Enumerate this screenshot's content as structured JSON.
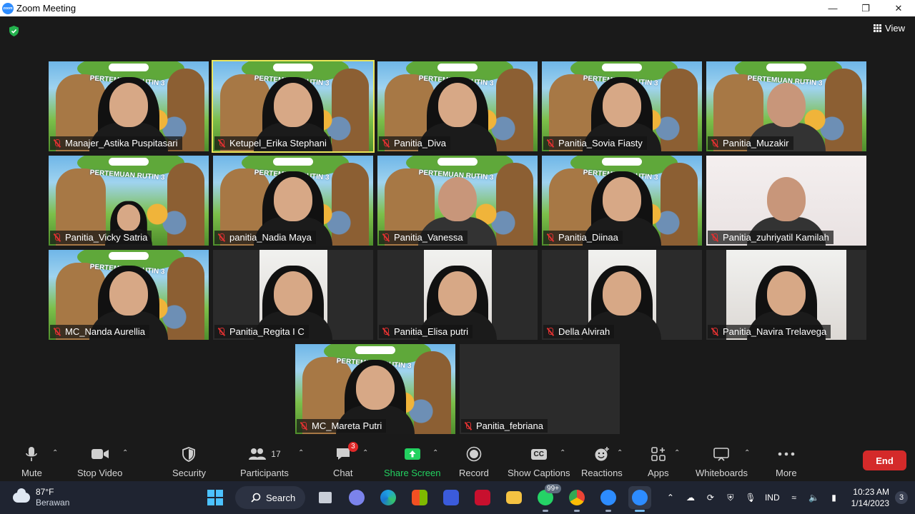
{
  "window": {
    "title": "Zoom Meeting",
    "app_icon_text": "zoom"
  },
  "header": {
    "view_label": "View"
  },
  "participants": [
    {
      "name": "Manajer_Astika Puspitasari"
    },
    {
      "name": "Ketupel_Erika Stephani"
    },
    {
      "name": "Panitia_Diva"
    },
    {
      "name": "Panitia_Sovia Fiasty"
    },
    {
      "name": "Panitia_Muzakir"
    },
    {
      "name": "Panitia_Vicky Satria"
    },
    {
      "name": "panitia_Nadia Maya"
    },
    {
      "name": "Panitia_Vanessa"
    },
    {
      "name": "Panitia_Diinaa"
    },
    {
      "name": "Panitia_zuhriyatil Kamilah"
    },
    {
      "name": "MC_Nanda Aurellia"
    },
    {
      "name": "Panitia_Regita I C"
    },
    {
      "name": "Panitia_Elisa putri"
    },
    {
      "name": "Della Alvirah"
    },
    {
      "name": "Panitia_Navira Trelavega"
    },
    {
      "name": "MC_Mareta Putri"
    },
    {
      "name": "Panitia_febriana"
    }
  ],
  "virtual_background_text": "PERTEMUAN RUTIN 3",
  "toolbar": {
    "mute": "Mute",
    "stop_video": "Stop Video",
    "security": "Security",
    "participants": "Participants",
    "participants_count": "17",
    "chat": "Chat",
    "chat_badge": "3",
    "share_screen": "Share Screen",
    "record": "Record",
    "show_captions": "Show Captions",
    "captions_icon": "CC",
    "reactions": "Reactions",
    "apps": "Apps",
    "whiteboards": "Whiteboards",
    "more": "More",
    "end": "End"
  },
  "taskbar": {
    "weather_temp": "87°F",
    "weather_desc": "Berawan",
    "search_label": "Search",
    "whatsapp_badge": "99+",
    "language": "IND",
    "time": "10:23 AM",
    "date": "1/14/2023",
    "notifications": "3"
  },
  "colors": {
    "active_speaker": "#e9e55a",
    "share_green": "#23d160",
    "end_red": "#d42a2a",
    "muted_red": "#e03131"
  }
}
